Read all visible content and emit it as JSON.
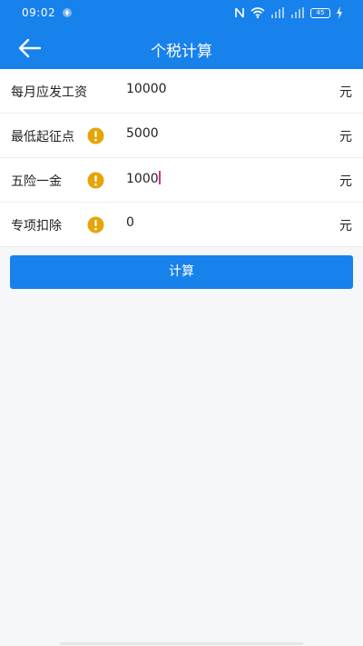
{
  "status_bar": {
    "time": "09:02",
    "battery": "45"
  },
  "header": {
    "title": "个税计算"
  },
  "form": {
    "rows": [
      {
        "label": "每月应发工资",
        "value": "10000",
        "unit": "元",
        "has_info": false
      },
      {
        "label": "最低起征点",
        "value": "5000",
        "unit": "元",
        "has_info": true
      },
      {
        "label": "五险一金",
        "value": "1000",
        "unit": "元",
        "has_info": true,
        "focused": true
      },
      {
        "label": "专项扣除",
        "value": "0",
        "unit": "元",
        "has_info": true
      }
    ]
  },
  "calc_button": {
    "label": "计算"
  },
  "colors": {
    "primary": "#1781ec",
    "info": "#e5a50a",
    "caret": "#d0338f"
  },
  "icons": {
    "back": "arrow-left-icon",
    "info": "exclamation-circle-icon"
  }
}
